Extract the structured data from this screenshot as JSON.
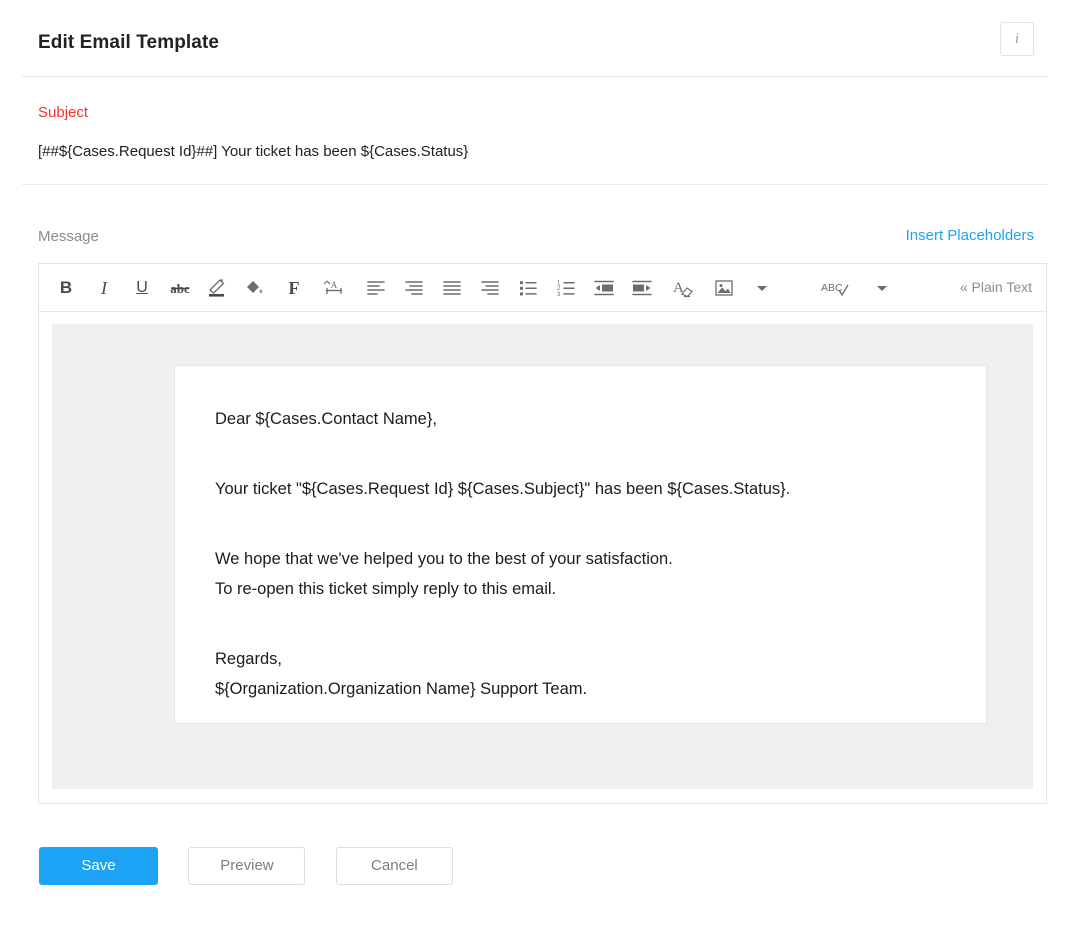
{
  "header": {
    "title": "Edit Email Template",
    "info_icon": "info-icon",
    "info_glyph": "i"
  },
  "subject": {
    "label": "Subject",
    "label_color": "#f8302a",
    "value": "[##${Cases.Request Id}##] Your ticket has been ${Cases.Status}"
  },
  "message": {
    "label": "Message",
    "insert_placeholders_label": "Insert Placeholders",
    "insert_placeholders_color": "#1ca3f5"
  },
  "toolbar": {
    "items": [
      {
        "name": "bold-icon",
        "label": "B"
      },
      {
        "name": "italic-icon",
        "label": "I"
      },
      {
        "name": "underline-icon",
        "label": "U"
      },
      {
        "name": "strikethrough-icon",
        "label": "abc"
      },
      {
        "name": "text-color-icon",
        "label": ""
      },
      {
        "name": "background-color-icon",
        "label": ""
      },
      {
        "name": "font-family-icon",
        "label": "F"
      },
      {
        "name": "line-height-icon",
        "label": ""
      },
      {
        "name": "align-left-icon",
        "label": ""
      },
      {
        "name": "align-center-icon",
        "label": ""
      },
      {
        "name": "align-justify-icon",
        "label": ""
      },
      {
        "name": "align-right-icon",
        "label": ""
      },
      {
        "name": "bullet-list-icon",
        "label": ""
      },
      {
        "name": "numbered-list-icon",
        "label": ""
      },
      {
        "name": "outdent-icon",
        "label": ""
      },
      {
        "name": "indent-icon",
        "label": ""
      },
      {
        "name": "clear-formatting-icon",
        "label": ""
      },
      {
        "name": "insert-image-icon",
        "label": ""
      },
      {
        "name": "more-options-icon",
        "label": ""
      },
      {
        "name": "spellcheck-icon",
        "label": "ABC"
      },
      {
        "name": "spellcheck-dropdown-icon",
        "label": ""
      }
    ],
    "plain_text_label": "« Plain Text"
  },
  "email": {
    "greeting": "Dear ${Cases.Contact Name},",
    "ticket_line": "Your ticket \"${Cases.Request Id} ${Cases.Subject}\" has been ${Cases.Status}.",
    "hope_line": "We hope that we've helped you to the best of your satisfaction.",
    "reopen_line": "To re-open this ticket simply reply to this email.",
    "regards": "Regards,",
    "signature": "${Organization.Organization Name} Support Team."
  },
  "footer": {
    "save_label": "Save",
    "preview_label": "Preview",
    "cancel_label": "Cancel",
    "save_color": "#1ca3f5"
  }
}
